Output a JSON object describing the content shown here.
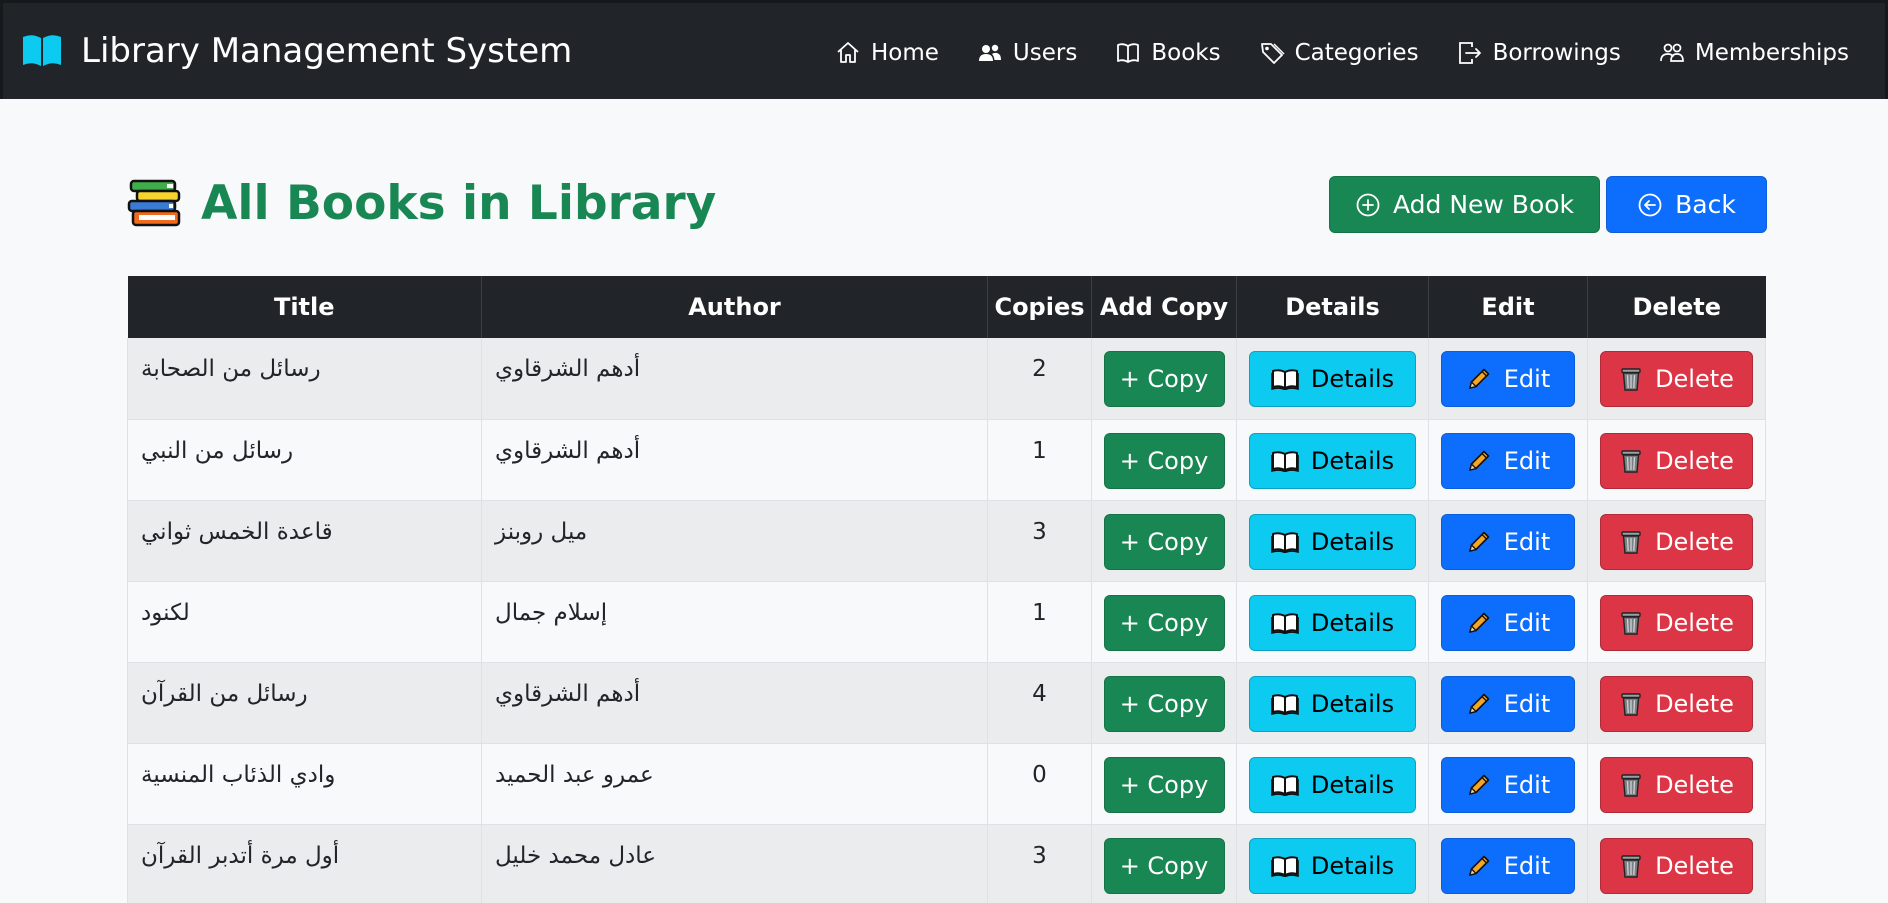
{
  "brand": {
    "title": "Library Management System"
  },
  "nav": {
    "items": [
      {
        "label": "Home",
        "icon": "home-icon"
      },
      {
        "label": "Users",
        "icon": "users-icon"
      },
      {
        "label": "Books",
        "icon": "book-icon"
      },
      {
        "label": "Categories",
        "icon": "tag-icon"
      },
      {
        "label": "Borrowings",
        "icon": "box-arrow-right-icon"
      },
      {
        "label": "Memberships",
        "icon": "people-icon"
      }
    ]
  },
  "page": {
    "title": "All Books in Library",
    "add_label": "Add New Book",
    "back_label": "Back"
  },
  "table": {
    "columns": [
      "Title",
      "Author",
      "Copies",
      "Add Copy",
      "Details",
      "Edit",
      "Delete"
    ],
    "actions": {
      "copy": "+ Copy",
      "details": "Details",
      "edit": "Edit",
      "delete": "Delete"
    },
    "rows": [
      {
        "title": "رسائل من الصحابة",
        "author": "أدهم الشرقاوي",
        "copies": "2"
      },
      {
        "title": "رسائل من النبي",
        "author": "أدهم الشرقاوي",
        "copies": "1"
      },
      {
        "title": "قاعدة الخمس ثواني",
        "author": "ميل روبنز",
        "copies": "3"
      },
      {
        "title": "لكنود",
        "author": "إسلام جمال",
        "copies": "1"
      },
      {
        "title": "رسائل من القرآن",
        "author": "أدهم الشرقاوي",
        "copies": "4"
      },
      {
        "title": "وادي الذئاب المنسية",
        "author": "عمرو عبد الحميد",
        "copies": "0"
      },
      {
        "title": "أول مرة أتدبر القرآن",
        "author": "عادل محمد خليل",
        "copies": "3"
      }
    ]
  },
  "colors": {
    "navbar": "#212529",
    "primary": "#0d6efd",
    "success": "#198754",
    "info": "#0dcaf0",
    "danger": "#dc3545"
  }
}
